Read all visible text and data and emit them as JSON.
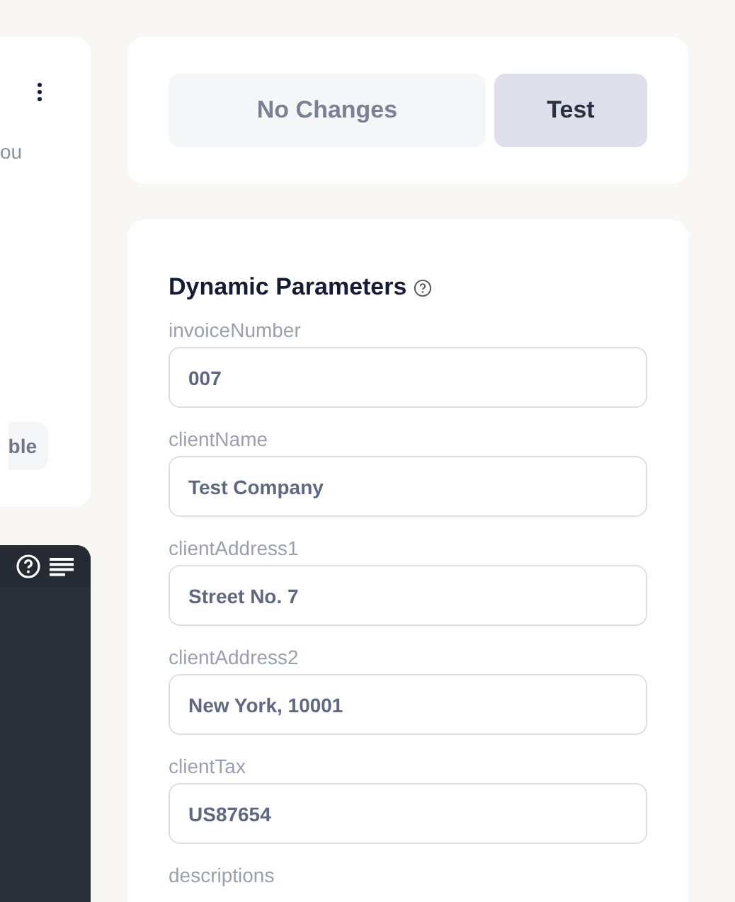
{
  "left_card": {
    "text": "ou",
    "button": "ble"
  },
  "actions": [
    {
      "label": "No Changes",
      "disabled": true
    },
    {
      "label": "Test",
      "disabled": false
    }
  ],
  "parameters_card": {
    "title": "Dynamic Parameters",
    "parameters": [
      {
        "name": "invoiceNumber",
        "value": "007"
      },
      {
        "name": "clientName",
        "value": "Test Company"
      },
      {
        "name": "clientAddress1",
        "value": "Street No. 7"
      },
      {
        "name": "clientAddress2",
        "value": "New York, 10001"
      },
      {
        "name": "clientTax",
        "value": "US87654"
      },
      {
        "name": "descriptions"
      }
    ]
  }
}
